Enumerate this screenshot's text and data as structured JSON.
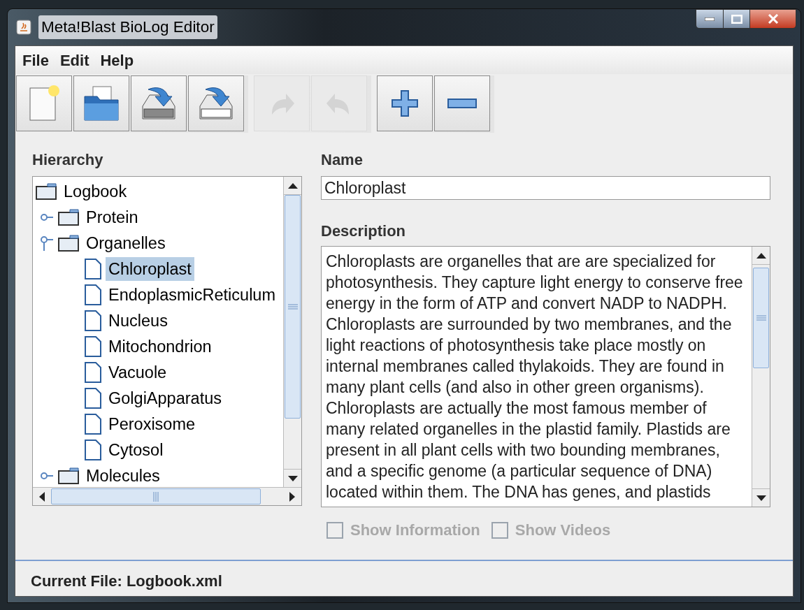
{
  "window": {
    "title": "Meta!Blast BioLog Editor"
  },
  "menu": [
    "File",
    "Edit",
    "Help"
  ],
  "toolbar": [
    {
      "buttons": [
        {
          "kind": "new",
          "disabled": false
        },
        {
          "kind": "open",
          "disabled": false
        },
        {
          "kind": "save",
          "disabled": false
        },
        {
          "kind": "saveas",
          "disabled": false
        }
      ]
    },
    {
      "buttons": [
        {
          "kind": "redo",
          "disabled": true
        },
        {
          "kind": "undo",
          "disabled": true
        }
      ]
    },
    {
      "buttons": [
        {
          "kind": "add",
          "disabled": false
        },
        {
          "kind": "remove",
          "disabled": false
        }
      ]
    }
  ],
  "hierarchy": {
    "label": "Hierarchy",
    "tree": [
      {
        "label": "Logbook",
        "kind": "folder",
        "selected": false,
        "children": [
          {
            "label": "Protein",
            "kind": "folder",
            "expanded": false,
            "selected": false
          },
          {
            "label": "Organelles",
            "kind": "folder",
            "expanded": true,
            "selected": false,
            "children": [
              {
                "label": "Chloroplast",
                "kind": "leaf",
                "selected": true
              },
              {
                "label": "EndoplasmicReticulum",
                "kind": "leaf",
                "selected": false
              },
              {
                "label": "Nucleus",
                "kind": "leaf",
                "selected": false
              },
              {
                "label": "Mitochondrion",
                "kind": "leaf",
                "selected": false
              },
              {
                "label": "Vacuole",
                "kind": "leaf",
                "selected": false
              },
              {
                "label": "GolgiApparatus",
                "kind": "leaf",
                "selected": false
              },
              {
                "label": "Peroxisome",
                "kind": "leaf",
                "selected": false
              },
              {
                "label": "Cytosol",
                "kind": "leaf",
                "selected": false
              }
            ]
          },
          {
            "label": "Molecules",
            "kind": "folder",
            "expanded": false,
            "selected": false
          }
        ]
      }
    ]
  },
  "name": {
    "label": "Name",
    "value": "Chloroplast"
  },
  "description": {
    "label": "Description",
    "value": "Chloroplasts are organelles that are are specialized for photosynthesis. They capture light energy to conserve free energy in the form of ATP and convert NADP to NADPH. Chloroplasts are surrounded by two membranes, and the light reactions of photosynthesis take place mostly on internal membranes called thylakoids. They are found in many plant cells (and also in other green organisms). Chloroplasts are actually the most famous member of many related organelles in the plastid family. Plastids are present in all plant cells with two bounding membranes, and a specific genome (a particular sequence of DNA) located within them. The DNA has genes, and plastids"
  },
  "options": [
    {
      "label": "Show Information",
      "checked": false,
      "disabled": true
    },
    {
      "label": "Show Videos",
      "checked": false,
      "disabled": true
    }
  ],
  "status_bar": "Current File: Logbook.xml"
}
